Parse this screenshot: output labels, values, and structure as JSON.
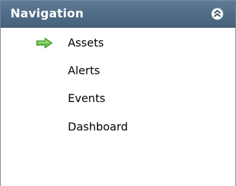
{
  "panel": {
    "title": "Navigation",
    "collapse_icon": "double-chevron-up-icon"
  },
  "items": [
    {
      "label": "Assets",
      "active": true,
      "indicator_icon": "green-arrow-right-icon"
    },
    {
      "label": "Alerts",
      "active": false
    },
    {
      "label": "Events",
      "active": false
    },
    {
      "label": "Dashboard",
      "active": false
    }
  ],
  "colors": {
    "header_bg": "#4f6b86",
    "header_text": "#ffffff",
    "arrow_fill": "#6cc04a",
    "arrow_stroke": "#3f8f2a",
    "item_text": "#000000"
  }
}
